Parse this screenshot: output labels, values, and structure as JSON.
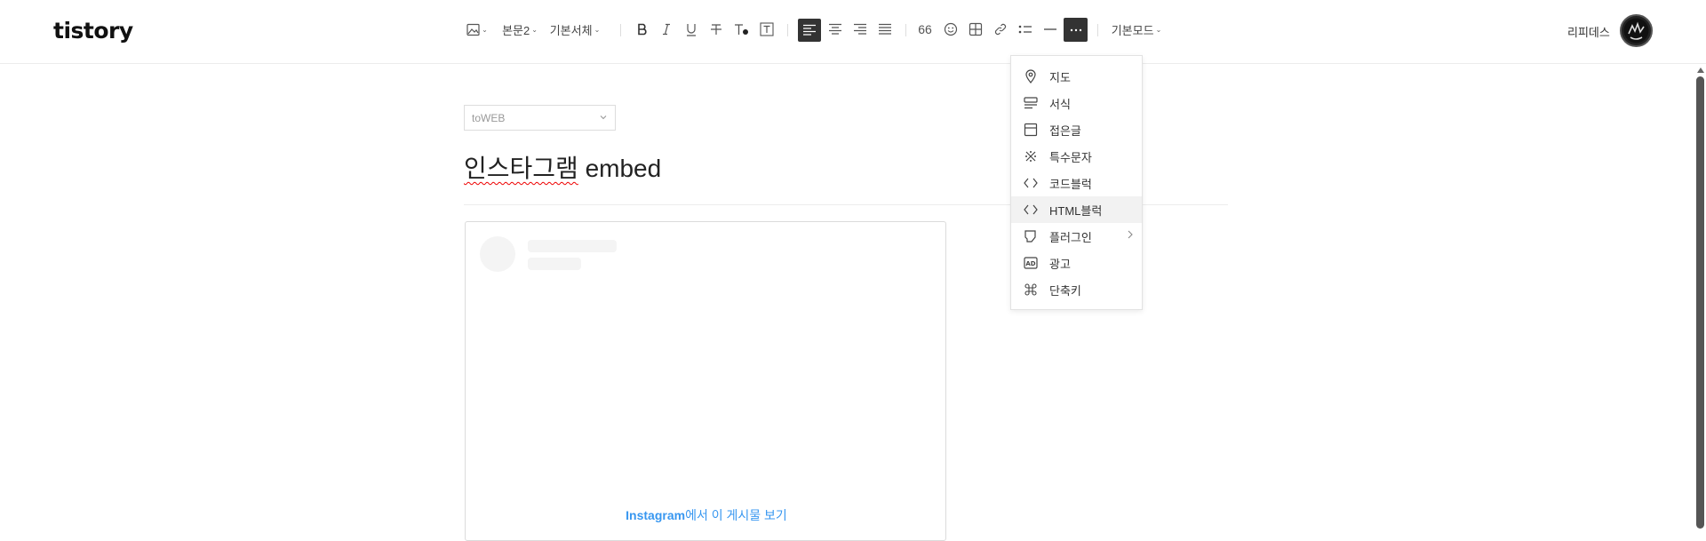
{
  "header": {
    "logo": "tistory",
    "toolbar": {
      "paragraph_style": "본문2",
      "font": "기본서체",
      "quote": "66",
      "mode": "기본모드"
    },
    "user_name": "리피데스"
  },
  "editor": {
    "category": "toWEB",
    "title_ko": "인스타그램",
    "title_rest": " embed",
    "embed": {
      "link_brand": "Instagram",
      "link_text": "에서 이 게시물 보기"
    }
  },
  "more_menu": {
    "items": [
      {
        "label": "지도",
        "icon": "map-pin-icon"
      },
      {
        "label": "서식",
        "icon": "template-icon"
      },
      {
        "label": "접은글",
        "icon": "fold-text-icon"
      },
      {
        "label": "특수문자",
        "icon": "special-char-icon"
      },
      {
        "label": "코드블럭",
        "icon": "code-icon"
      },
      {
        "label": "HTML블럭",
        "icon": "code-icon",
        "highlighted": true
      },
      {
        "label": "플러그인",
        "icon": "plugin-icon",
        "has_submenu": true
      },
      {
        "label": "광고",
        "icon": "ad-icon"
      },
      {
        "label": "단축키",
        "icon": "command-icon"
      }
    ]
  },
  "colors": {
    "accent_dark": "#333333",
    "link_blue": "#3897f0",
    "spellcheck_red": "#ee0000"
  }
}
